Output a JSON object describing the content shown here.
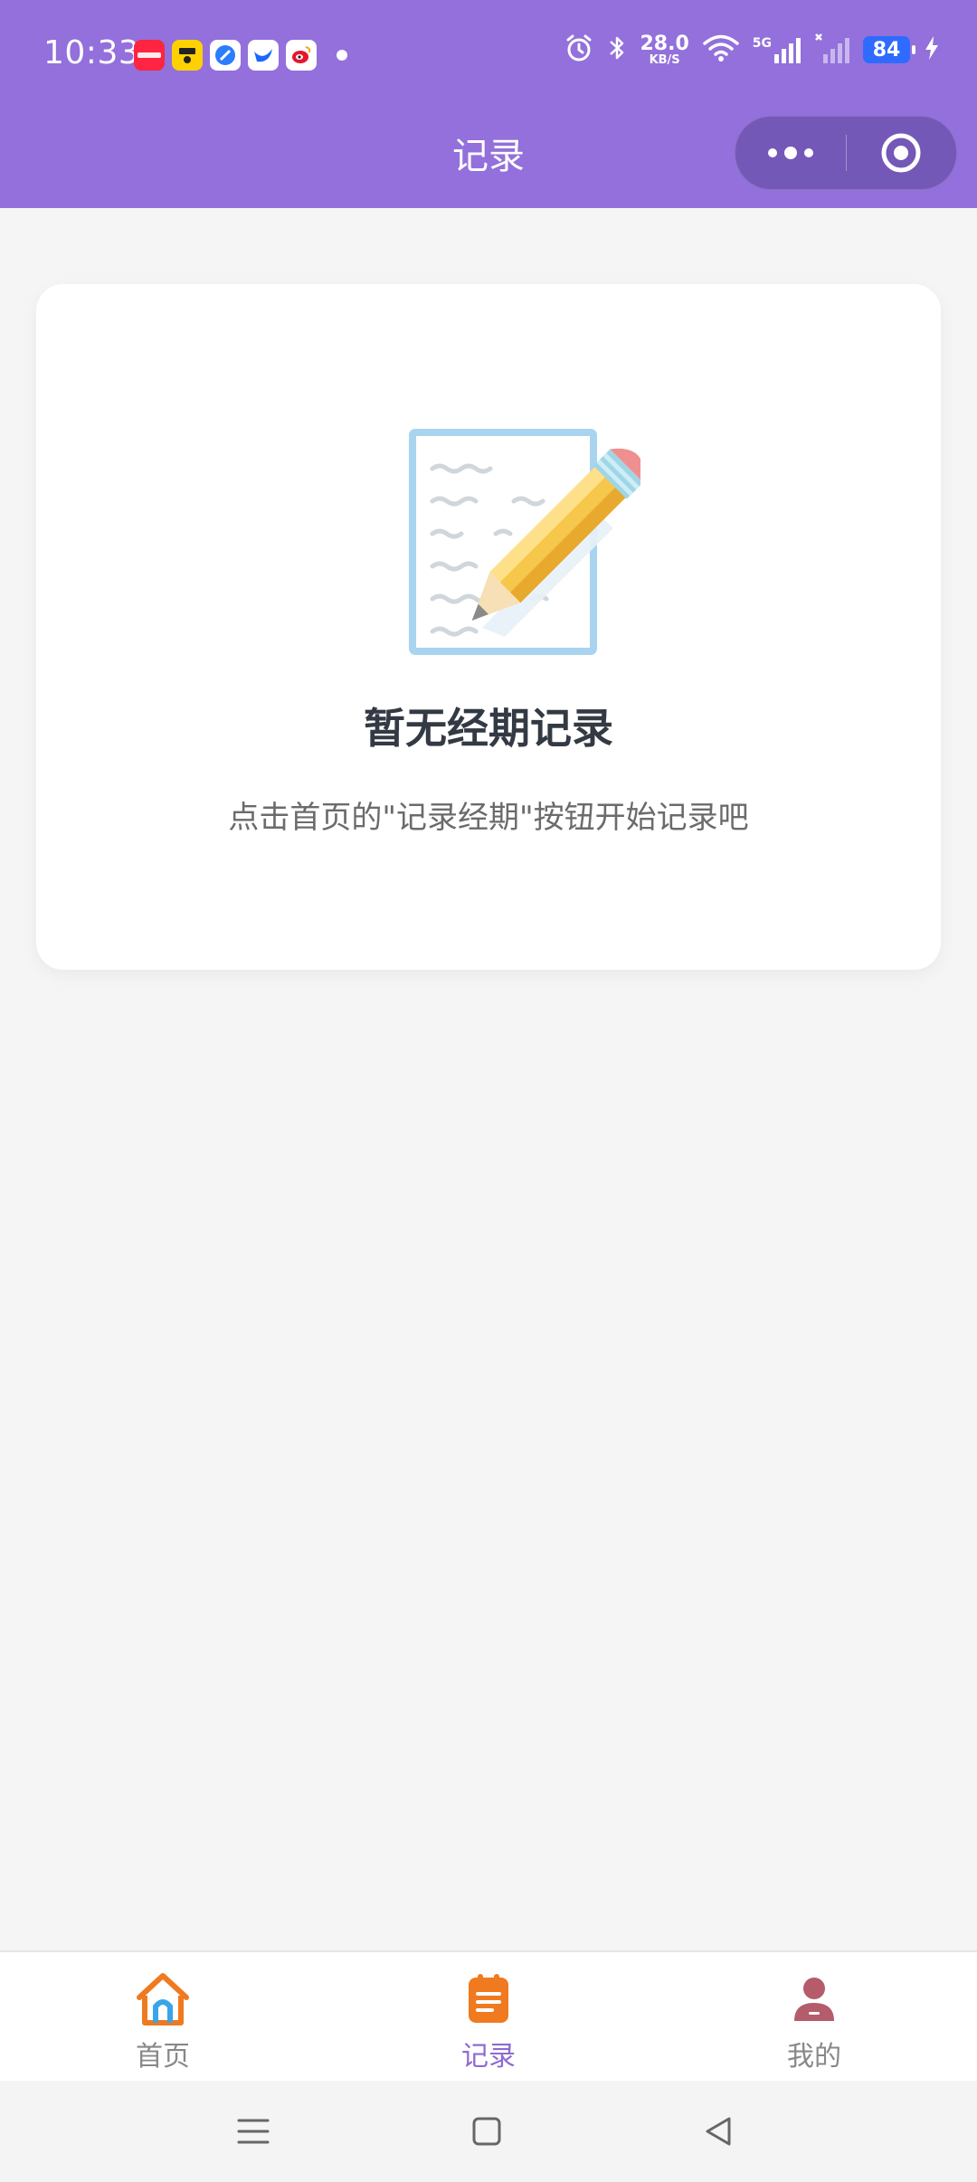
{
  "status_bar": {
    "time": "10:33",
    "network_speed_value": "28.0",
    "network_speed_unit": "KB/S",
    "network_type": "5G",
    "battery_level": "84",
    "app_icons": [
      "xiaohongshu-icon",
      "meituan-icon",
      "browser-icon",
      "feishu-icon",
      "weibo-icon"
    ]
  },
  "header": {
    "title": "记录",
    "background_color": "#9370db"
  },
  "empty_state": {
    "title": "暂无经期记录",
    "description": "点击首页的\"记录经期\"按钮开始记录吧",
    "illustration": "notepad-pencil-illustration"
  },
  "tabbar": {
    "active_index": 1,
    "items": [
      {
        "label": "首页",
        "icon": "home-icon"
      },
      {
        "label": "记录",
        "icon": "records-icon"
      },
      {
        "label": "我的",
        "icon": "profile-icon"
      }
    ],
    "active_color": "#8f6ad1"
  }
}
